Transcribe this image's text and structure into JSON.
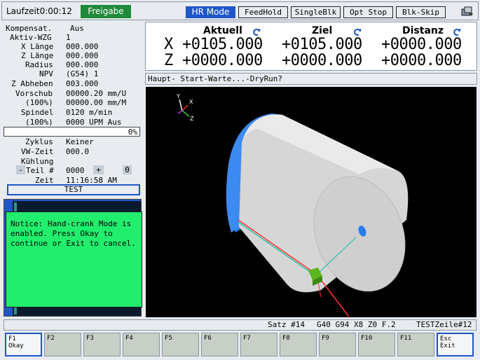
{
  "topbar": {
    "runtime": "Laufzeit0:00:12",
    "enable": "Freigabe",
    "mode": "HR Mode",
    "buttons": [
      "FeedHold",
      "SingleBlk",
      "Opt Stop",
      "Blk-Skip"
    ]
  },
  "left": {
    "comp_label": "Kompensat.",
    "comp_value": "Aus",
    "tool_label": "Aktiv-WZG",
    "tool_value": "1",
    "xlen_label": "X Länge",
    "xlen_value": "000.000",
    "zlen_label": "Z Länge",
    "zlen_value": "000.000",
    "radius_label": "Radius",
    "radius_value": "000.000",
    "npv_label": "NPV",
    "npv_value": "(G54) 1",
    "zlift_label": "Z Abheben",
    "zlift_value": "003.000",
    "feed_label": "Vorschub",
    "feed_value": "00000.20 mm/U",
    "feed_pct": "(100%)",
    "feed_value2": "00000.00 mm/M",
    "spindle_label": "Spindel",
    "spindle_value": "0120 m/min",
    "spindle_pct": "(100%)",
    "spindle_value2": "0000 UPM Aus",
    "progress_text": "0%",
    "progress": 0,
    "cycle_label": "Zyklus",
    "cycle_value": "Keiner",
    "dwell_label": "VW-Zeit",
    "dwell_value": "000.0",
    "coolant_label": "Kühlung",
    "part_minus": "-",
    "part_label": "Teil #",
    "part_value": "0000",
    "part_plus": "+",
    "part_count": "0",
    "time_label": "Zeit",
    "time_value": "11:16:58 AM",
    "program": "TEST"
  },
  "dro": {
    "headers": [
      "Aktuell",
      "Ziel",
      "Distanz"
    ],
    "x_label": "X",
    "z_label": "Z",
    "x_values": [
      "+0105.000",
      "+0105.000",
      "+0000.000"
    ],
    "z_values": [
      "+0000.000",
      "+0000.000",
      "+0000.000"
    ]
  },
  "status_line": "Haupt-  Start-Warte...-DryRun?",
  "viewport": {
    "axis_y": "Y",
    "axis_x": "X",
    "axis_z": "Z"
  },
  "bottom": {
    "block": "Satz #14",
    "gcodes": "G40 G94 X8 Z0 F.2",
    "file": "TESTZeile#12"
  },
  "fkeys": [
    [
      "F1",
      "Okay"
    ],
    [
      "F2",
      ""
    ],
    [
      "F3",
      ""
    ],
    [
      "F4",
      ""
    ],
    [
      "F5",
      ""
    ],
    [
      "F6",
      ""
    ],
    [
      "F7",
      ""
    ],
    [
      "F8",
      ""
    ],
    [
      "F9",
      ""
    ],
    [
      "F10",
      ""
    ],
    [
      "F11",
      ""
    ],
    [
      "Esc",
      "Exit"
    ]
  ],
  "notice": "Notice: Hand-crank Mode is\nenabled. Press Okay to\ncontinue or Exit to cancel.",
  "colors": {
    "accent": "#1f57c9",
    "enable": "#1f8a3a",
    "notice": "#22ee6e"
  }
}
